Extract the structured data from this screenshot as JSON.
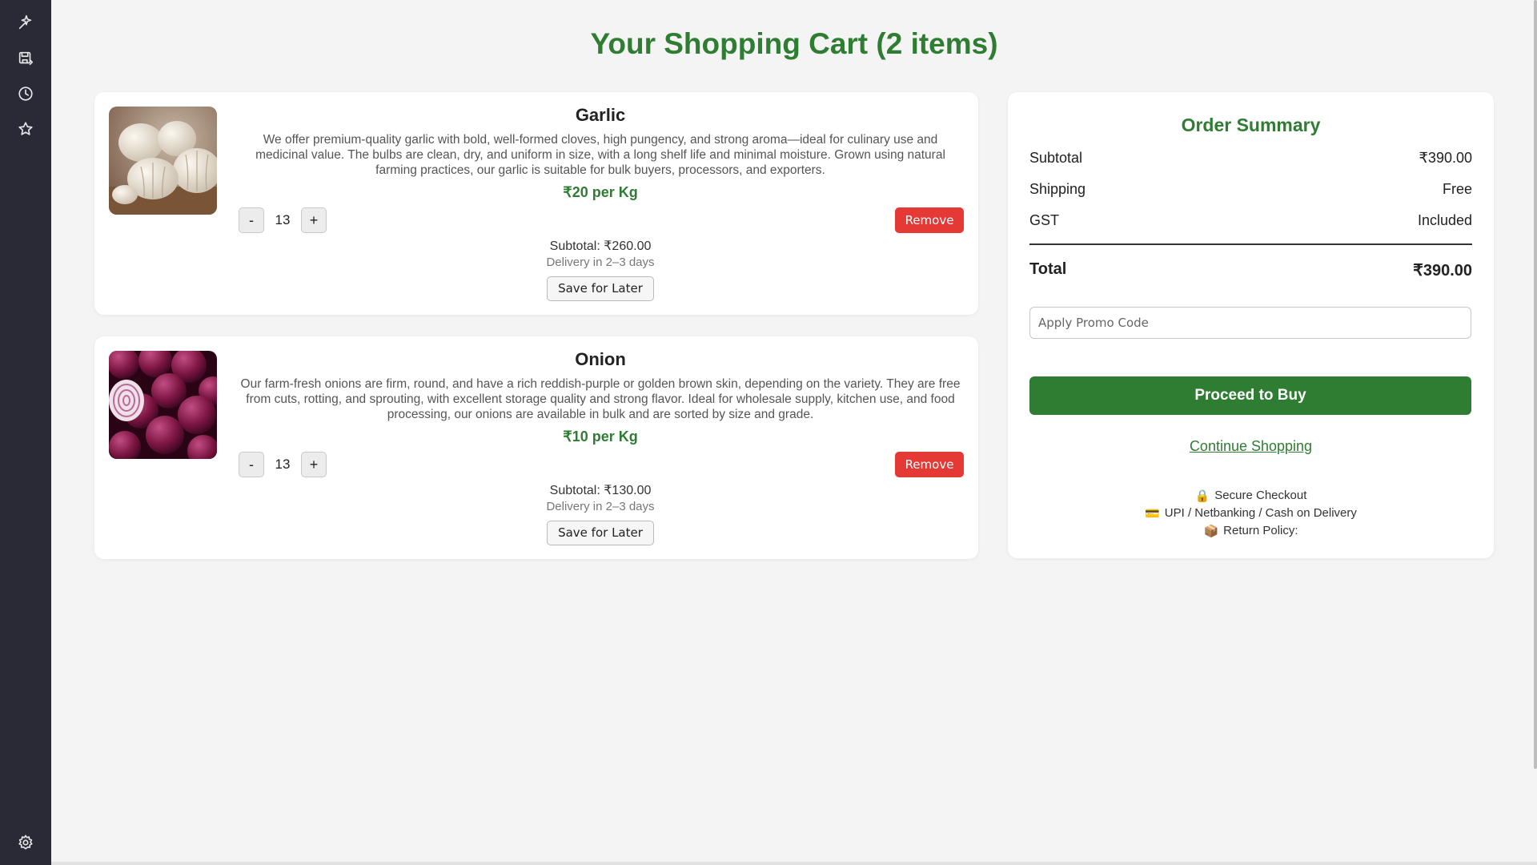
{
  "sidebar": {
    "icons": [
      "sparkle-icon",
      "save-disk-icon",
      "history-clock-icon",
      "star-icon",
      "settings-gear-icon"
    ]
  },
  "page": {
    "title": "Your Shopping Cart (2 items)"
  },
  "items": [
    {
      "name": "Garlic",
      "image": "garlic-photo",
      "description": "We offer premium-quality garlic with bold, well-formed cloves, high pungency, and strong aroma—ideal for culinary use and medicinal value. The bulbs are clean, dry, and uniform in size, with a long shelf life and minimal moisture. Grown using natural farming practices, our garlic is suitable for bulk buyers, processors, and exporters.",
      "price": "₹20 per Kg",
      "qty_minus": "-",
      "quantity": "13",
      "qty_plus": "+",
      "remove_label": "Remove",
      "subtotal": "Subtotal: ₹260.00",
      "delivery": "Delivery in 2–3 days",
      "save_label": "Save for Later"
    },
    {
      "name": "Onion",
      "image": "red-onion-photo",
      "description": "Our farm-fresh onions are firm, round, and have a rich reddish-purple or golden brown skin, depending on the variety. They are free from cuts, rotting, and sprouting, with excellent storage quality and strong flavor. Ideal for wholesale supply, kitchen use, and food processing, our onions are available in bulk and are sorted by size and grade.",
      "price": "₹10 per Kg",
      "qty_minus": "-",
      "quantity": "13",
      "qty_plus": "+",
      "remove_label": "Remove",
      "subtotal": "Subtotal: ₹130.00",
      "delivery": "Delivery in 2–3 days",
      "save_label": "Save for Later"
    }
  ],
  "summary": {
    "title": "Order Summary",
    "rows": [
      {
        "label": "Subtotal",
        "value": "₹390.00"
      },
      {
        "label": "Shipping",
        "value": "Free"
      },
      {
        "label": "GST",
        "value": "Included"
      }
    ],
    "total_label": "Total",
    "total_value": "₹390.00",
    "promo_placeholder": "Apply Promo Code",
    "proceed_label": "Proceed to Buy",
    "continue_label": "Continue Shopping",
    "notes": [
      {
        "icon": "🔒",
        "icon_name": "lock-icon",
        "text": "Secure Checkout"
      },
      {
        "icon": "💳",
        "icon_name": "credit-card-icon",
        "text": "UPI / Netbanking / Cash on Delivery"
      },
      {
        "icon": "📦",
        "icon_name": "package-icon",
        "text": "Return Policy:"
      }
    ]
  },
  "colors": {
    "brand_green": "#2e7d32",
    "remove_red": "#e53935",
    "sidebar_bg": "#2a2a36",
    "page_bg": "#f4f4f4"
  }
}
